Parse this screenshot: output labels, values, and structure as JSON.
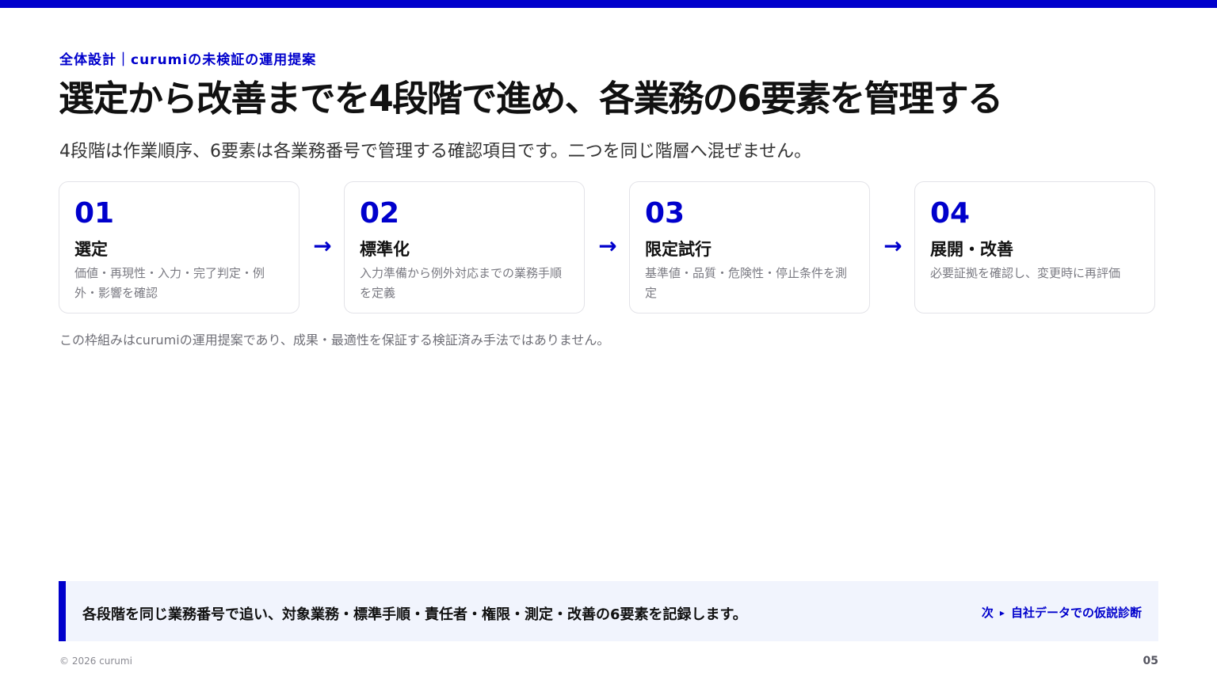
{
  "header": {
    "eyebrow": "全体設計｜curumiの未検証の運用提案",
    "title": "選定から改善までを4段階で進め、各業務の6要素を管理する",
    "subtitle": "4段階は作業順序、6要素は各業務番号で管理する確認項目です。二つを同じ階層へ混ぜません。"
  },
  "steps": [
    {
      "number": "01",
      "title": "選定",
      "description": "価値・再現性・入力・完了判定・例外・影響を確認"
    },
    {
      "number": "02",
      "title": "標準化",
      "description": "入力準備から例外対応までの業務手順を定義"
    },
    {
      "number": "03",
      "title": "限定試行",
      "description": "基準値・品質・危険性・停止条件を測定"
    },
    {
      "number": "04",
      "title": "展開・改善",
      "description": "必要証拠を確認し、変更時に再評価"
    }
  ],
  "arrow_glyph": "→",
  "note": "この枠組みはcurumiの運用提案であり、成果・最適性を保証する検証済み手法ではありません。",
  "summary": {
    "text": "各段階を同じ業務番号で追い、対象業務・標準手順・責任者・権限・測定・改善の6要素を記録します。",
    "next_prefix": "次",
    "next_label": "自社データでの仮説診断"
  },
  "footer": {
    "copyright": "© 2026 curumi",
    "page_number": "05"
  },
  "colors": {
    "accent": "#0000cc",
    "summary_background": "#f1f4fd",
    "card_border": "#e3e3e8"
  }
}
